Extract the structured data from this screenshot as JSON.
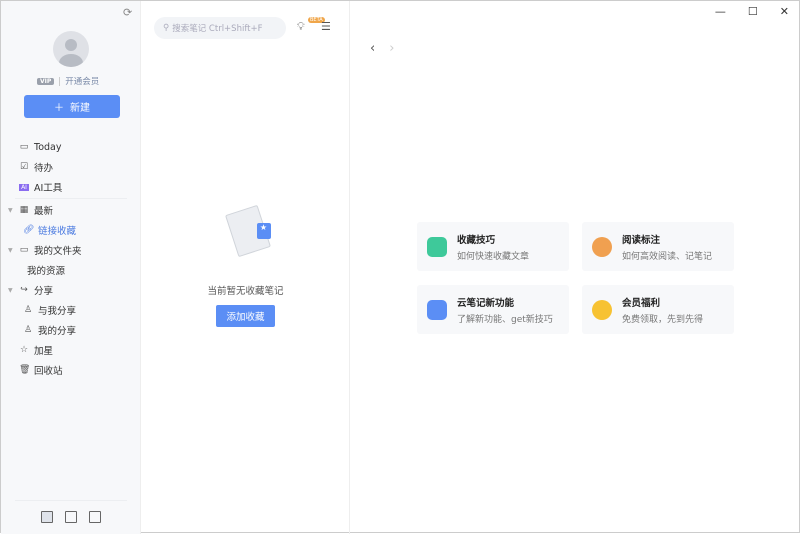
{
  "sidebar": {
    "vip_badge": "VIP",
    "open_membership": "开通会员",
    "new_button": "新建",
    "items": [
      {
        "label": "Today"
      },
      {
        "label": "待办"
      },
      {
        "label": "AI工具"
      },
      {
        "label": "最新"
      },
      {
        "label": "链接收藏"
      },
      {
        "label": "我的文件夹"
      },
      {
        "label": "我的资源"
      },
      {
        "label": "分享"
      },
      {
        "label": "与我分享"
      },
      {
        "label": "我的分享"
      },
      {
        "label": "加星"
      },
      {
        "label": "回收站"
      }
    ]
  },
  "list": {
    "search_placeholder": "搜索笔记 Ctrl+Shift+F",
    "beta_badge": "BETA",
    "empty_text": "当前暂无收藏笔记",
    "add_button": "添加收藏"
  },
  "main": {
    "cards": [
      {
        "title": "收藏技巧",
        "desc": "如何快速收藏文章",
        "color": "#3ec99a"
      },
      {
        "title": "阅读标注",
        "desc": "如何高效阅读、记笔记",
        "color": "#f0a050"
      },
      {
        "title": "云笔记新功能",
        "desc": "了解新功能、get新技巧",
        "color": "#5b8ef5"
      },
      {
        "title": "会员福利",
        "desc": "免费领取，先到先得",
        "color": "#f7c232"
      }
    ]
  }
}
